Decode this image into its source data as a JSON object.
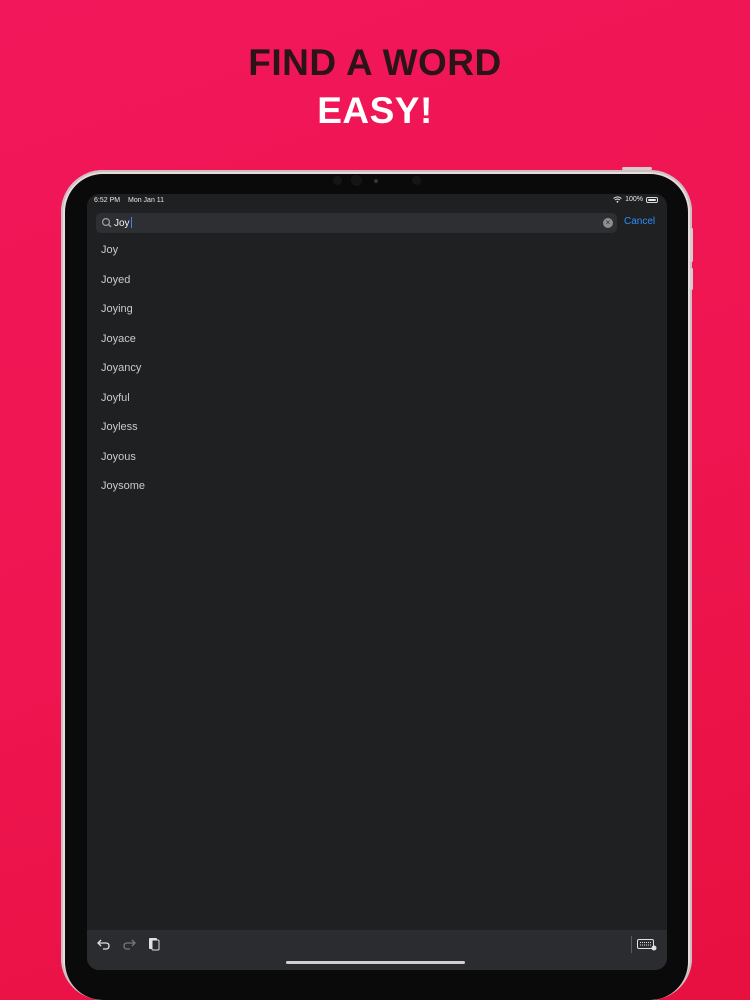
{
  "promo": {
    "line1": "FIND A WORD",
    "line2": "EASY!"
  },
  "status_bar": {
    "time": "6:52 PM",
    "date": "Mon Jan 11",
    "battery": "100%"
  },
  "search": {
    "query": "Joy",
    "cancel_label": "Cancel"
  },
  "results": [
    "Joy",
    "Joyed",
    "Joying",
    "Joyace",
    "Joyancy",
    "Joyful",
    "Joyless",
    "Joyous",
    "Joysome"
  ],
  "colors": {
    "background": "#f0164f",
    "accent": "#2d8cff",
    "screen": "#1f2022"
  },
  "icons": [
    "search-icon",
    "clear-icon",
    "undo-icon",
    "redo-icon",
    "paste-icon",
    "keyboard-dismiss-icon",
    "wifi-icon",
    "battery-icon"
  ]
}
